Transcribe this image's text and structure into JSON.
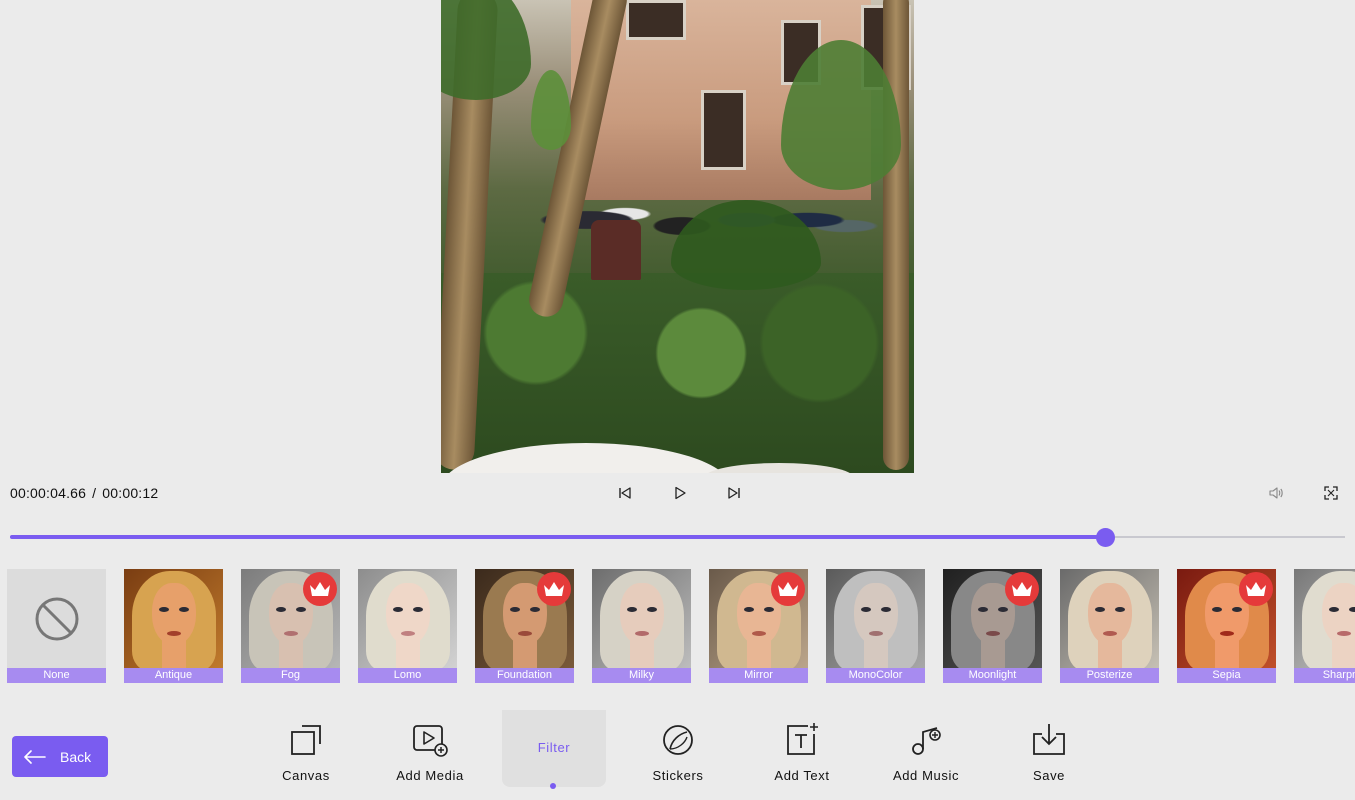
{
  "player": {
    "current_time": "00:00:04.66",
    "separator": "/",
    "total_time": "00:00:12",
    "progress": 0.82
  },
  "icons": {
    "previous": "skip-back-icon",
    "play": "play-icon",
    "next": "skip-forward-icon",
    "volume": "volume-icon",
    "fullscreen": "fullscreen-icon",
    "premium": "crown-icon"
  },
  "filters": [
    {
      "label": "None",
      "premium": false
    },
    {
      "label": "Antique",
      "premium": false
    },
    {
      "label": "Fog",
      "premium": true
    },
    {
      "label": "Lomo",
      "premium": false
    },
    {
      "label": "Foundation",
      "premium": true
    },
    {
      "label": "Milky",
      "premium": false
    },
    {
      "label": "Mirror",
      "premium": true
    },
    {
      "label": "MonoColor",
      "premium": false
    },
    {
      "label": "Moonlight",
      "premium": true
    },
    {
      "label": "Posterize",
      "premium": false
    },
    {
      "label": "Sepia",
      "premium": true
    },
    {
      "label": "Sharpne",
      "premium": false
    }
  ],
  "toolbar": {
    "back": "Back",
    "canvas": "Canvas",
    "add_media": "Add Media",
    "filter": "Filter",
    "stickers": "Stickers",
    "add_text": "Add Text",
    "add_music": "Add Music",
    "save": "Save"
  },
  "colors": {
    "accent": "#7a5cf0",
    "label_bg": "#a78bf0",
    "premium_badge": "#e53a3a"
  }
}
